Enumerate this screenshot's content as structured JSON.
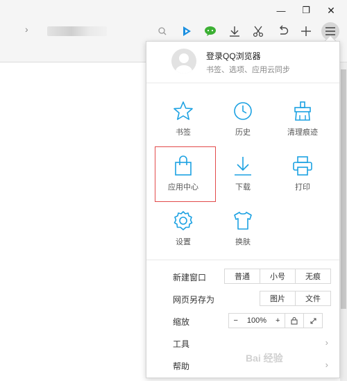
{
  "titlebar": {
    "minimize_glyph": "—",
    "maximize_glyph": "❐",
    "close_glyph": "✕"
  },
  "toolbar": {
    "address_chevron": "›"
  },
  "accent_color": "#1ba1e2",
  "menu": {
    "login_title": "登录QQ浏览器",
    "login_subtitle": "书签、选项、应用云同步",
    "grid": [
      {
        "label": "书签",
        "icon": "star-icon"
      },
      {
        "label": "历史",
        "icon": "clock-icon"
      },
      {
        "label": "清理痕迹",
        "icon": "broom-icon"
      },
      {
        "label": "应用中心",
        "icon": "bag-icon"
      },
      {
        "label": "下载",
        "icon": "download-icon"
      },
      {
        "label": "打印",
        "icon": "printer-icon"
      },
      {
        "label": "设置",
        "icon": "gear-icon"
      },
      {
        "label": "换肤",
        "icon": "shirt-icon"
      }
    ],
    "new_window": {
      "label": "新建窗口",
      "options": [
        "普通",
        "小号",
        "无痕"
      ]
    },
    "save_page": {
      "label": "网页另存为",
      "options": [
        "图片",
        "文件"
      ]
    },
    "zoom": {
      "label": "缩放",
      "minus": "−",
      "value": "100%",
      "plus": "+"
    },
    "tools": {
      "label": "工具",
      "arrow": "›"
    },
    "help": {
      "label": "帮助",
      "arrow": "›"
    }
  },
  "watermark": "Bai 经验"
}
